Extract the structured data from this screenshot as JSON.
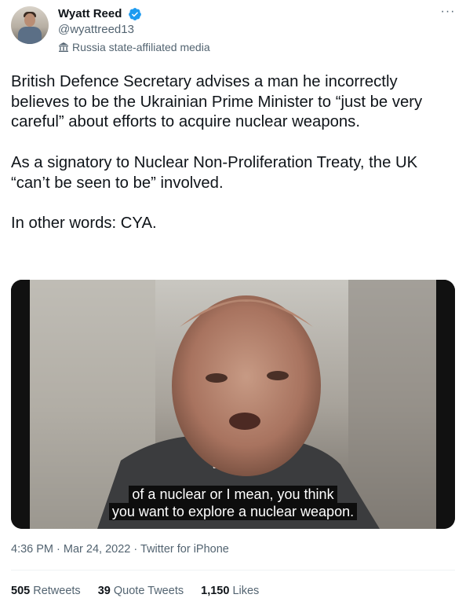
{
  "author": {
    "name": "Wyatt Reed",
    "handle": "@wyattreed13",
    "label": "Russia state-affiliated media"
  },
  "more_label": "···",
  "tweet": {
    "paragraphs": [
      "British Defence Secretary advises a man he incorrectly believes to be the Ukrainian Prime Minister to “just be very careful” about efforts to acquire nuclear weapons.",
      "As a signatory to Nuclear Non-Proliferation Treaty, the UK “can’t be seen to be” involved.",
      "In other words: CYA."
    ]
  },
  "media": {
    "caption_line1": "of a nuclear or I mean, you think",
    "caption_line2": "you want to explore a nuclear weapon."
  },
  "meta": {
    "time": "4:36 PM",
    "date": "Mar 24, 2022",
    "app": "Twitter for iPhone",
    "separator": "·"
  },
  "stats": {
    "retweets_count": "505",
    "retweets_label": "Retweets",
    "quotes_count": "39",
    "quotes_label": "Quote Tweets",
    "likes_count": "1,150",
    "likes_label": "Likes"
  },
  "colors": {
    "verified_blue": "#1d9bf0",
    "secondary_text": "#536471",
    "primary_text": "#0f1419"
  },
  "icons": [
    "verified-badge-icon",
    "state-media-icon",
    "more-options-icon"
  ]
}
